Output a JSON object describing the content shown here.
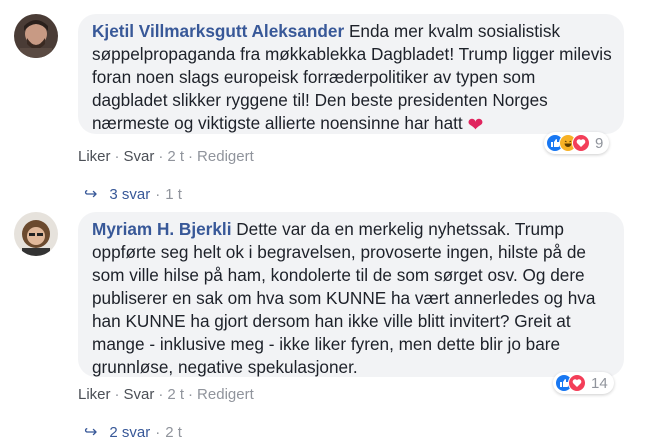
{
  "comments": [
    {
      "author": "Kjetil Villmarksgutt Aleksander",
      "text": " Enda mer kvalm sosialistisk søppelpropaganda fra møkkablekka Dagbladet! Trump ligger milevis foran noen slags europeisk forræderpolitiker av typen som dagbladet slikker ryggene til! Den beste presidenten Norges nærmeste og viktigste allierte noensinne har hatt ",
      "emoji": "❤",
      "reactions": {
        "icons": [
          "like-icon",
          "haha-icon",
          "love-icon"
        ],
        "count": "9"
      },
      "actions": {
        "like": "Liker",
        "reply": "Svar",
        "time": "2 t",
        "edited": "Redigert"
      },
      "replies": {
        "label": "3 svar",
        "time": "1 t"
      }
    },
    {
      "author": "Myriam H. Bjerkli",
      "text": " Dette var da en merkelig nyhetssak. Trump oppførte seg helt ok i begravelsen, provoserte ingen, hilste på de som ville hilse på ham, kondolerte til de som sørget osv. Og dere publiserer en sak om hva som KUNNE ha vært annerledes og hva han KUNNE ha gjort dersom han ikke ville blitt invitert? Greit at mange - inklusive meg - ikke liker fyren, men dette blir jo bare grunnløse, negative spekulasjoner.",
      "reactions": {
        "icons": [
          "like-icon",
          "love-icon"
        ],
        "count": "14"
      },
      "actions": {
        "like": "Liker",
        "reply": "Svar",
        "time": "2 t",
        "edited": "Redigert"
      },
      "replies": {
        "label": "2 svar",
        "time": "2 t"
      }
    }
  ],
  "colors": {
    "link": "#385898",
    "bubble": "#f2f3f5",
    "meta": "#90949c",
    "like": "#1877f2",
    "love": "#f33e58",
    "haha": "#f7b125"
  }
}
